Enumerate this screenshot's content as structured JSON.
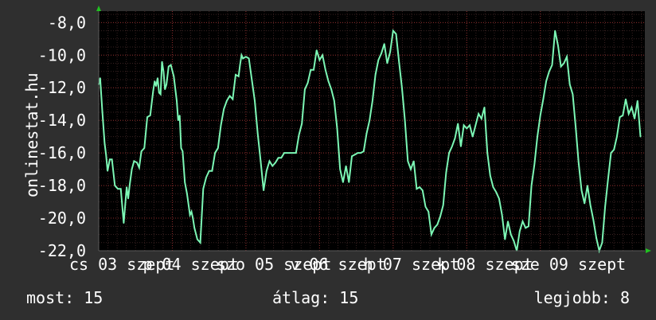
{
  "watermark": "onlinestat.hu",
  "footer": {
    "now": "most: 15",
    "avg": "átlag: 15",
    "best": "legjobb: 8"
  },
  "colors": {
    "background": "#2f2f2f",
    "plot_background": "#000000",
    "series": "#7cf7b5",
    "grid_major": "#8a2a2a",
    "grid_minor": "#3a2222",
    "axis_arrow": "#21c121"
  },
  "chart_data": {
    "type": "line",
    "title": "",
    "xlabel": "",
    "ylabel": "",
    "ylim": [
      -22.0,
      -7.3
    ],
    "grid": true,
    "y_ticks": [
      -8.0,
      -10.0,
      -12.0,
      -14.0,
      -16.0,
      -18.0,
      -20.0,
      -22.0
    ],
    "y_tick_labels": [
      "-8,0",
      "-10,0",
      "-12,0",
      "-14,0",
      "-16,0",
      "-18,0",
      "-20,0",
      "-22,0"
    ],
    "x_tick_labels": [
      "cs 03 szept",
      "p 04 szept",
      "szo 05 szept",
      "v 06 szept",
      "h 07 szept",
      "k 08 szept",
      "sze 09 szept"
    ],
    "x_range_days": [
      0,
      7.42
    ],
    "series": [
      {
        "x": [
          0.0,
          0.02,
          0.05,
          0.08,
          0.1,
          0.12,
          0.15,
          0.18,
          0.22,
          0.26,
          0.3,
          0.34,
          0.38,
          0.4,
          0.42,
          0.45,
          0.48,
          0.52,
          0.55,
          0.58,
          0.62,
          0.66,
          0.7,
          0.74,
          0.76,
          0.78,
          0.8,
          0.82,
          0.84,
          0.86,
          0.88,
          0.9,
          0.92,
          0.95,
          0.98,
          1.02,
          1.06,
          1.08,
          1.1,
          1.12,
          1.14,
          1.17,
          1.2,
          1.24,
          1.26,
          1.28,
          1.3,
          1.34,
          1.38,
          1.42,
          1.46,
          1.5,
          1.54,
          1.58,
          1.62,
          1.66,
          1.7,
          1.74,
          1.78,
          1.82,
          1.86,
          1.9,
          1.92,
          1.94,
          1.96,
          2.0,
          2.04,
          2.08,
          2.12,
          2.16,
          2.2,
          2.24,
          2.28,
          2.32,
          2.36,
          2.4,
          2.44,
          2.48,
          2.52,
          2.56,
          2.6,
          2.64,
          2.68,
          2.72,
          2.76,
          2.8,
          2.84,
          2.88,
          2.92,
          2.96,
          3.0,
          3.04,
          3.08,
          3.12,
          3.16,
          3.2,
          3.24,
          3.28,
          3.32,
          3.36,
          3.4,
          3.44,
          3.48,
          3.52,
          3.56,
          3.6,
          3.64,
          3.68,
          3.72,
          3.76,
          3.8,
          3.84,
          3.88,
          3.92,
          3.96,
          4.0,
          4.04,
          4.08,
          4.12,
          4.16,
          4.2,
          4.24,
          4.28,
          4.32,
          4.36,
          4.4,
          4.44,
          4.48,
          4.52,
          4.56,
          4.6,
          4.64,
          4.68,
          4.72,
          4.76,
          4.8,
          4.84,
          4.88,
          4.92,
          4.96,
          5.0,
          5.04,
          5.08,
          5.12,
          5.16,
          5.2,
          5.24,
          5.28,
          5.32,
          5.36,
          5.4,
          5.44,
          5.48,
          5.52,
          5.56,
          5.6,
          5.64,
          5.68,
          5.72,
          5.76,
          5.8,
          5.84,
          5.88,
          5.92,
          5.96,
          6.0,
          6.04,
          6.08,
          6.12,
          6.16,
          6.2,
          6.24,
          6.28,
          6.32,
          6.36,
          6.4,
          6.44,
          6.48,
          6.52,
          6.56,
          6.6,
          6.64,
          6.68,
          6.72,
          6.76,
          6.8,
          6.84,
          6.88,
          6.92,
          6.96,
          7.0,
          7.04,
          7.08,
          7.12,
          7.16,
          7.2,
          7.24,
          7.28,
          7.32,
          7.36
        ],
        "y": [
          -11.8,
          -11.4,
          -13.5,
          -15.4,
          -16.1,
          -17.1,
          -16.4,
          -16.4,
          -18.0,
          -18.2,
          -18.2,
          -20.3,
          -18.1,
          -18.8,
          -18.0,
          -17.0,
          -16.5,
          -16.6,
          -16.9,
          -15.9,
          -15.7,
          -13.8,
          -13.7,
          -12.2,
          -11.6,
          -11.9,
          -11.4,
          -12.3,
          -12.4,
          -10.4,
          -11.0,
          -12.1,
          -11.8,
          -10.7,
          -10.6,
          -11.3,
          -12.8,
          -14.0,
          -13.7,
          -15.7,
          -15.9,
          -17.8,
          -18.5,
          -19.8,
          -19.6,
          -20.0,
          -20.6,
          -21.3,
          -21.5,
          -18.2,
          -17.5,
          -17.1,
          -17.1,
          -16.0,
          -15.7,
          -14.3,
          -13.3,
          -12.8,
          -12.5,
          -12.7,
          -11.2,
          -11.3,
          -10.6,
          -10.0,
          -10.2,
          -10.1,
          -10.2,
          -11.5,
          -12.8,
          -14.8,
          -16.5,
          -18.3,
          -17.1,
          -16.5,
          -16.8,
          -16.6,
          -16.3,
          -16.3,
          -16.0,
          -16.0,
          -16.0,
          -16.0,
          -16.0,
          -14.9,
          -14.2,
          -12.1,
          -11.7,
          -10.9,
          -10.9,
          -9.7,
          -10.3,
          -10.0,
          -10.9,
          -11.6,
          -12.1,
          -12.8,
          -14.5,
          -17.0,
          -17.8,
          -16.8,
          -17.8,
          -16.2,
          -16.1,
          -16.0,
          -16.0,
          -15.9,
          -14.8,
          -14.0,
          -12.8,
          -11.2,
          -10.3,
          -9.9,
          -9.3,
          -10.5,
          -9.8,
          -8.5,
          -8.7,
          -10.4,
          -12.0,
          -14.0,
          -16.5,
          -17.0,
          -16.5,
          -18.2,
          -18.1,
          -18.3,
          -19.3,
          -19.6,
          -21.0,
          -20.6,
          -20.4,
          -19.9,
          -19.2,
          -17.2,
          -16.0,
          -15.6,
          -15.1,
          -14.2,
          -15.6,
          -14.3,
          -14.5,
          -14.3,
          -15.0,
          -14.3,
          -13.6,
          -13.9,
          -13.2,
          -16.0,
          -17.4,
          -18.1,
          -18.4,
          -18.8,
          -19.8,
          -21.3,
          -20.2,
          -21.0,
          -21.4,
          -22.0,
          -20.8,
          -20.2,
          -20.6,
          -20.5,
          -18.0,
          -16.7,
          -15.0,
          -13.7,
          -12.7,
          -11.6,
          -11.0,
          -10.6,
          -8.5,
          -9.4,
          -10.7,
          -10.5,
          -10.1,
          -11.8,
          -12.4,
          -14.4,
          -16.6,
          -18.3,
          -19.1,
          -18.0,
          -19.2,
          -20.1,
          -21.2,
          -22.0,
          -21.5,
          -19.3,
          -17.6,
          -16.0,
          -15.8,
          -15.0,
          -13.8,
          -13.7,
          -12.7,
          -13.6,
          -13.2,
          -13.9,
          -12.8,
          -15.0
        ]
      }
    ]
  }
}
